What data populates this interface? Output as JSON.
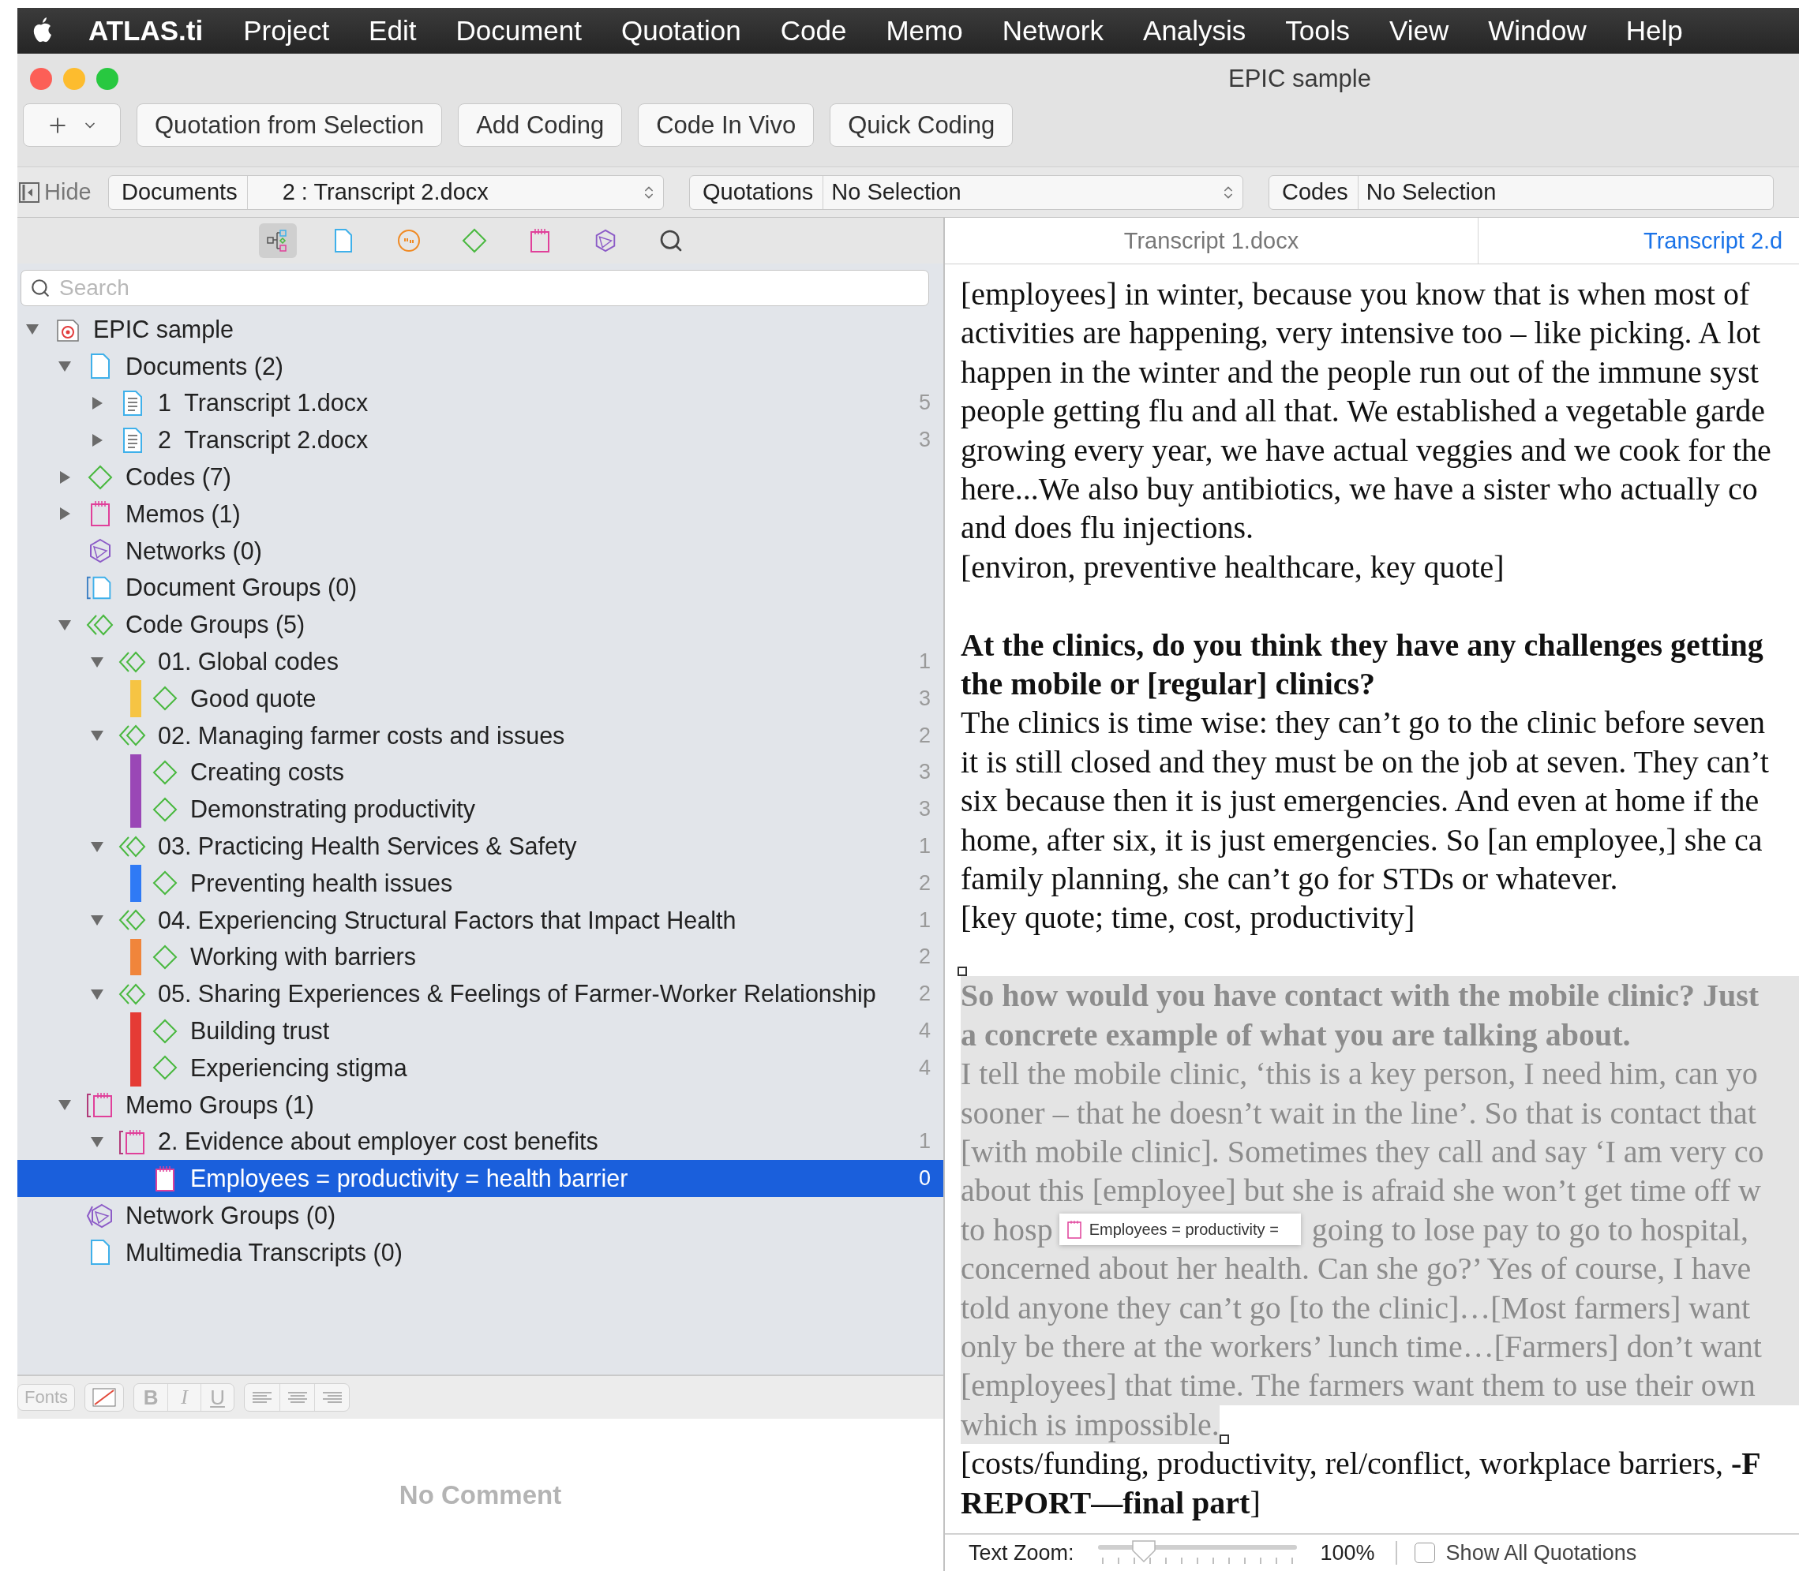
{
  "menu_bar": {
    "app_name": "ATLAS.ti",
    "items": [
      "Project",
      "Edit",
      "Document",
      "Quotation",
      "Code",
      "Memo",
      "Network",
      "Analysis",
      "Tools",
      "View",
      "Window",
      "Help"
    ]
  },
  "window": {
    "title": "EPIC sample"
  },
  "toolbar": {
    "buttons": [
      "Quotation from Selection",
      "Add Coding",
      "Code In Vivo",
      "Quick Coding"
    ]
  },
  "navigator": {
    "hide_label": "Hide",
    "selectors": [
      {
        "label": "Documents",
        "value": "2 : Transcript 2.docx",
        "stepper": true
      },
      {
        "label": "Quotations",
        "value": "No Selection",
        "stepper": true
      },
      {
        "label": "Codes",
        "value": "No Selection",
        "stepper": false
      }
    ]
  },
  "browser": {
    "view_buttons": [
      {
        "kind": "hierarchy",
        "selected": true
      },
      {
        "kind": "documents",
        "selected": false
      },
      {
        "kind": "quotations",
        "selected": false
      },
      {
        "kind": "codes",
        "selected": false
      },
      {
        "kind": "memos",
        "selected": false
      },
      {
        "kind": "networks",
        "selected": false
      },
      {
        "kind": "search",
        "selected": false
      }
    ],
    "search": {
      "placeholder": "Search"
    },
    "tree": [
      {
        "label": "EPIC sample",
        "kind": "project",
        "expanded": true,
        "selected": false,
        "children": [
          {
            "label": "Documents (2)",
            "kind": "documents",
            "expanded": true,
            "selected": false,
            "children": [
              {
                "label": "1  Transcript 1.docx",
                "kind": "document",
                "expanded": false,
                "count": "5",
                "selected": false
              },
              {
                "label": "2  Transcript 2.docx",
                "kind": "document",
                "expanded": false,
                "count": "3",
                "selected": false
              }
            ]
          },
          {
            "label": "Codes (7)",
            "kind": "code",
            "expanded": false,
            "selected": false
          },
          {
            "label": "Memos (1)",
            "kind": "memo",
            "expanded": false,
            "selected": false
          },
          {
            "label": "Networks (0)",
            "kind": "network",
            "selected": false
          },
          {
            "label": "Document Groups (0)",
            "kind": "document_group",
            "selected": false
          },
          {
            "label": "Code Groups (5)",
            "kind": "code_group",
            "expanded": true,
            "selected": false,
            "children": [
              {
                "label": "01. Global codes",
                "kind": "code_group",
                "expanded": true,
                "count": "1",
                "selected": false,
                "children": [
                  {
                    "label": "Good quote",
                    "kind": "code",
                    "color": "#f6c443",
                    "count": "3",
                    "selected": false
                  }
                ]
              },
              {
                "label": "02. Managing farmer costs and issues",
                "kind": "code_group",
                "expanded": true,
                "count": "2",
                "selected": false,
                "children": [
                  {
                    "label": "Creating costs",
                    "kind": "code",
                    "color": "#9a47b6",
                    "count": "3",
                    "selected": false
                  },
                  {
                    "label": "Demonstrating productivity",
                    "kind": "code",
                    "color": "#9a47b6",
                    "count": "3",
                    "selected": false
                  }
                ]
              },
              {
                "label": "03. Practicing Health Services & Safety",
                "kind": "code_group",
                "expanded": true,
                "count": "1",
                "selected": false,
                "children": [
                  {
                    "label": "Preventing health issues",
                    "kind": "code",
                    "color": "#2f7af5",
                    "count": "2",
                    "selected": false
                  }
                ]
              },
              {
                "label": "04. Experiencing Structural Factors that Impact Health",
                "kind": "code_group",
                "expanded": true,
                "count": "1",
                "selected": false,
                "children": [
                  {
                    "label": "Working with barriers",
                    "kind": "code",
                    "color": "#f0853b",
                    "count": "2",
                    "selected": false
                  }
                ]
              },
              {
                "label": "05. Sharing Experiences & Feelings of Farmer-Worker Relationship",
                "kind": "code_group",
                "expanded": true,
                "count": "2",
                "selected": false,
                "children": [
                  {
                    "label": "Building trust",
                    "kind": "code",
                    "color": "#e53b35",
                    "count": "4",
                    "selected": false
                  },
                  {
                    "label": "Experiencing stigma",
                    "kind": "code",
                    "color": "#e53b35",
                    "count": "4",
                    "selected": false
                  }
                ]
              }
            ]
          },
          {
            "label": "Memo Groups (1)",
            "kind": "memo_group",
            "expanded": true,
            "selected": false,
            "children": [
              {
                "label": "2. Evidence about employer cost benefits",
                "kind": "memo_group",
                "expanded": true,
                "count": "1",
                "selected": false,
                "children": [
                  {
                    "label": "Employees = productivity = health barrier",
                    "kind": "memo",
                    "count": "0",
                    "selected": true
                  }
                ]
              }
            ]
          },
          {
            "label": "Network Groups (0)",
            "kind": "network_group",
            "selected": false
          },
          {
            "label": "Multimedia Transcripts (0)",
            "kind": "documents",
            "selected": false
          }
        ]
      }
    ]
  },
  "comment_editor": {
    "fonts_label": "Fonts",
    "style_buttons": [
      "B",
      "I",
      "U"
    ],
    "empty_text": "No Comment"
  },
  "document_view": {
    "tabs": [
      {
        "label": "Transcript 1.docx",
        "selected": false
      },
      {
        "label": "Transcript 2.d",
        "selected": true
      }
    ],
    "paragraphs": [
      {
        "kind": "body",
        "lines": [
          "[employees] in winter, because you know that is when most of",
          "activities are happening, very intensive too – like picking. A lot",
          "happen in the winter and the people run out of the immune syst",
          "people getting flu and all that. We established a vegetable garde",
          "growing every year, we have actual veggies and we cook for the",
          "here...We also buy antibiotics, we have a sister who actually co",
          "and does flu injections.",
          "[environ, preventive healthcare, key quote]"
        ]
      },
      {
        "kind": "question",
        "lines": [
          "At the clinics, do you think they have any challenges getting",
          "the mobile or [regular] clinics?"
        ]
      },
      {
        "kind": "body",
        "lines": [
          "The clinics is time wise: they can’t go to the clinic before seven",
          "it is still closed and they must be on the job at seven. They can’t",
          "six because then it is just emergencies. And even at home if the",
          "home, after six, it is just emergencies. So [an employee,] she ca",
          "family planning, she can’t go for STDs or whatever.",
          "[key quote; time, cost, productivity]"
        ]
      },
      {
        "kind": "quotation",
        "question": [
          "So how would you have contact with the mobile clinic? Just",
          "a concrete example of what you are talking about."
        ],
        "lines": [
          {
            "text": "I tell the mobile clinic, ‘this is a key person, I need him, can yo"
          },
          {
            "text": "sooner – that he doesn’t wait in the line’. So that is contact that"
          },
          {
            "text": "[with mobile clinic]. Sometimes they call and say ‘I am very co"
          },
          {
            "text": "about this [employee] but she is afraid she won’t get time off w"
          },
          {
            "text": "to hosp",
            "memo": "Employees = productivity =",
            "after": "going to lose pay to go to hospital,"
          },
          {
            "text": "concerned about her health. Can she go?’ Yes of course, I have"
          },
          {
            "text": "told anyone they can’t go [to the clinic]…[Most farmers] want"
          },
          {
            "text": "only be there at the workers’ lunch time…[Farmers] don’t want"
          },
          {
            "text": "[employees] that time. The farmers want them to use their own"
          },
          {
            "text": "which is impossible."
          }
        ]
      },
      {
        "kind": "body",
        "lines": [
          "[costs/funding, productivity, rel/conflict, workplace barriers, **-F**",
          "**REPORT—final part**]"
        ]
      }
    ]
  },
  "zoom_bar": {
    "label": "Text Zoom:",
    "level": 0.23,
    "reading": "100%",
    "show_all": {
      "label": "Show All Quotations",
      "checked": false
    }
  }
}
